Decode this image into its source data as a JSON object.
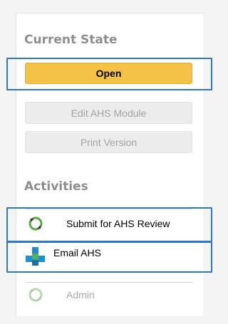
{
  "sections": {
    "current_state": "Current State",
    "activities": "Activities"
  },
  "buttons": {
    "open": "Open",
    "edit": "Edit AHS Module",
    "print": "Print Version"
  },
  "activities": [
    {
      "label": "Submit for AHS Review",
      "icon": "refresh-arrow-icon"
    },
    {
      "label": "Email AHS",
      "icon": "puzzle-blocks-icon"
    },
    {
      "label": "Admin",
      "icon": "refresh-arrow-icon"
    }
  ],
  "colors": {
    "accent": "#f4c246",
    "highlight_outline": "#2f78c1"
  }
}
